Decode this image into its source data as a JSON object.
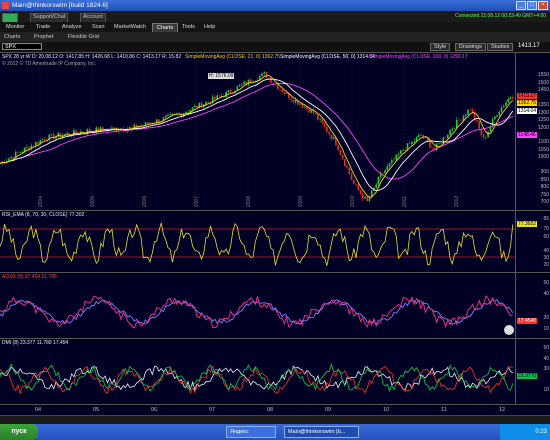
{
  "window": {
    "title": "Main@thinkorswim [build 1824.6]"
  },
  "menubar": {
    "items": [
      "Support/Chat",
      "Account"
    ],
    "time": "Connected 22.08.12 00:23:40 GMT+4:00"
  },
  "tabs": [
    {
      "label": "Monitor"
    },
    {
      "label": "Trade"
    },
    {
      "label": "Analyze"
    },
    {
      "label": "Scan"
    },
    {
      "label": "MarketWatch"
    },
    {
      "label": "Charts"
    },
    {
      "label": "Tools"
    },
    {
      "label": "Help"
    }
  ],
  "subbar": {
    "items": [
      "Charts",
      "Prophet",
      "Flexible Grid"
    ]
  },
  "chart_toolbar": {
    "symbol": "SPX",
    "right_buttons": [
      "Style",
      "Drawings",
      "Studies"
    ],
    "last_price": "1413.17"
  },
  "price_panel": {
    "header": "SPX 28 yr W D: 20.08.12  O: 1417.85  H: 1426.68  L: 1410.86  C: 1413.17  R: 15.82",
    "studies": [
      "SimpleMovingAvg (CLOSE, 21, 0)  1362.75",
      "SimpleMovingAvg (CLOSE, 50, 0)  1314.04",
      "SimpleMovingAvg (CLOSE, 100, 0)  1290.17"
    ],
    "copyright": "© 2012 © TD Ameritrade IP Company, Inc.",
    "high_label": "H: 1576.09",
    "ticks": [
      "1550",
      "1500",
      "1450",
      "1350",
      "1300",
      "1250",
      "1200",
      "1100",
      "1050",
      "1000",
      "900",
      "850",
      "800",
      "750",
      "700"
    ],
    "tags": [
      {
        "text": "1413.17",
        "color": "#ff3030"
      },
      {
        "text": "1362.75",
        "color": "#ffd200"
      },
      {
        "text": "1314.04",
        "color": "#ffffff"
      },
      {
        "text": "1148.46",
        "color": "#ff40ff"
      }
    ],
    "year_labels": [
      "2004",
      "2005",
      "2006",
      "2007",
      "2008",
      "2009",
      "2010",
      "2011",
      "2012"
    ]
  },
  "rsi_panel": {
    "header": "RSI_EMA (8, 70, 30, CLOSE)  77.302",
    "value": "77.3022",
    "ticks": [
      "85",
      "70",
      "60",
      "40",
      "30",
      "20"
    ]
  },
  "adx_panel": {
    "header": "ADXR (8)  17.454  21.785",
    "value": "17.4540",
    "ticks": [
      "50",
      "40",
      "20",
      "10"
    ]
  },
  "dmi_panel": {
    "header": "DMI (8)  23.377  11.789  17.454",
    "value": "23.3770",
    "ticks": [
      "50",
      "40",
      "30",
      "10"
    ]
  },
  "xaxis": {
    "labels": [
      "04",
      "05",
      "06",
      "07",
      "08",
      "09",
      "10",
      "11",
      "12"
    ]
  },
  "taskbar": {
    "start": "пуск",
    "tasks": [
      "Яндекс",
      "Main@thinkorswim [b..."
    ],
    "clock": "0:23"
  },
  "colors": {
    "background": "#000024",
    "up_candle": "#2bd12b",
    "down_candle": "#e03030",
    "sma21": "#ffd200",
    "sma50": "#ffffff",
    "sma100": "#ff40ff",
    "rsi": "#e8e020",
    "adx": "#ff2f8f",
    "adxr": "#8080ff",
    "dmi_plus": "#00d050",
    "dmi_minus": "#ff3030"
  }
}
